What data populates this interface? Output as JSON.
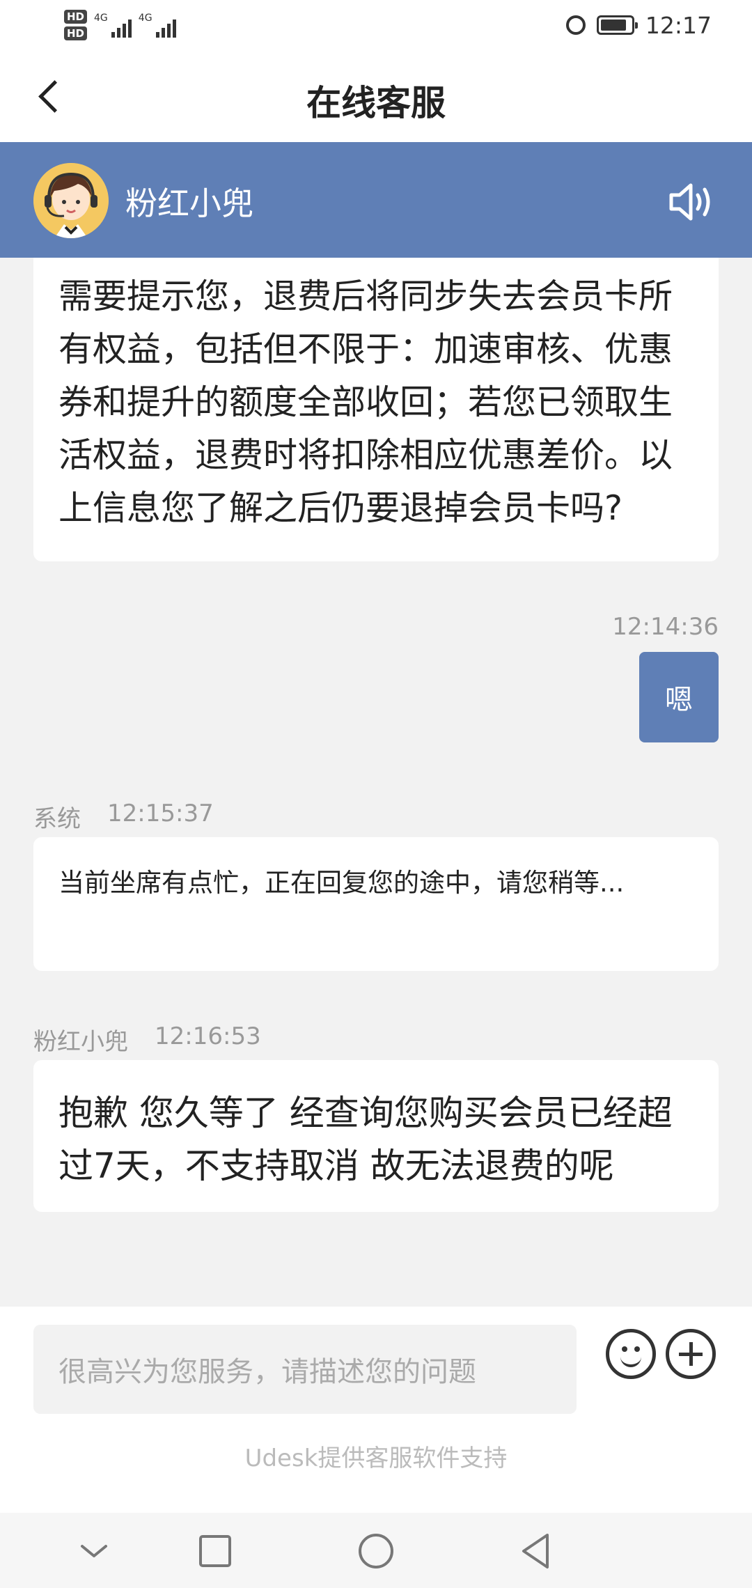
{
  "status_bar": {
    "hd1": "HD",
    "hd2": "HD",
    "net1": "4G",
    "net2": "4G",
    "time": "12:17",
    "icons": [
      "hd-icon",
      "signal-icon",
      "alarm-icon",
      "battery-icon"
    ]
  },
  "header": {
    "title": "在线客服",
    "back_icon": "chevron-left-icon"
  },
  "agent": {
    "name": "粉红小兜",
    "avatar_icon": "agent-avatar",
    "speaker_icon": "speaker-icon"
  },
  "messages": [
    {
      "side": "left",
      "text": "需要提示您，退费后将同步失去会员卡所有权益，包括但不限于：加速审核、优惠券和提升的额度全部收回；若您已领取生活权益，退费时将扣除相应优惠差价。以上信息您了解之后仍要退掉会员卡吗?",
      "visible_text": "所有权益，包括但不限于：加速审核、优惠券和提升的额度全部收回；若您已领取生活权益，退费时将扣除相应优惠差价。以上信息您了解之后仍要退掉会员卡吗?"
    },
    {
      "side": "right",
      "time": "12:14:36",
      "text": "嗯"
    },
    {
      "side": "left",
      "sender": "系统",
      "time": "12:15:37",
      "text": "当前坐席有点忙，正在回复您的途中，请您稍等..."
    },
    {
      "side": "left",
      "sender": "粉红小兜",
      "time": "12:16:53",
      "text": "抱歉 您久等了 经查询您购买会员已经超过7天，不支持取消 故无法退费的呢"
    }
  ],
  "input": {
    "placeholder": "很高兴为您服务，请描述您的问题",
    "emoji_icon": "smiley-icon",
    "plus_icon": "plus-circle-icon"
  },
  "footer": {
    "powered_by": "Udesk提供客服软件支持"
  },
  "nav": {
    "icons": [
      "nav-down-icon",
      "nav-recents-icon",
      "nav-home-icon",
      "nav-back-icon"
    ]
  },
  "colors": {
    "accent": "#5f7fb6",
    "background": "#f2f2f2"
  }
}
